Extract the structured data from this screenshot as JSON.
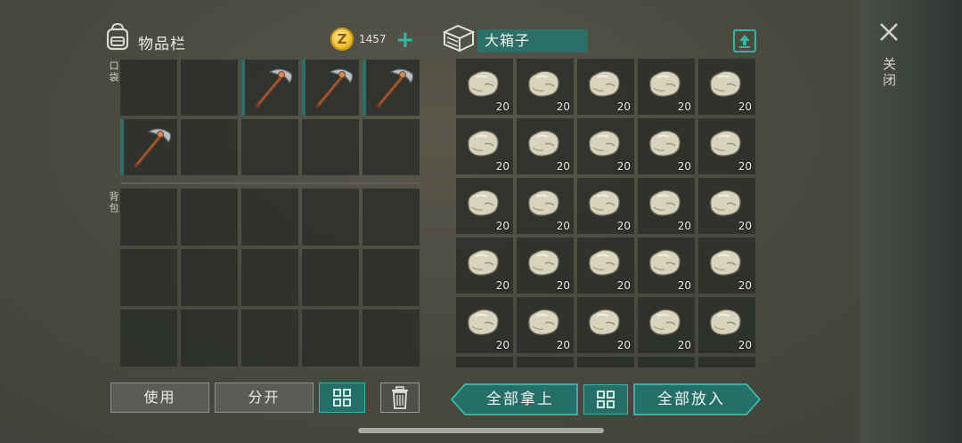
{
  "inventory": {
    "title": "物品栏",
    "pocket_label": "口袋",
    "backpack_label": "背包",
    "pocket_slots": [
      "",
      "",
      "pickaxe",
      "pickaxe",
      "pickaxe",
      "pickaxe",
      "",
      "",
      "",
      ""
    ],
    "backpack_slots": [
      "",
      "",
      "",
      "",
      "",
      "",
      "",
      "",
      "",
      "",
      "",
      "",
      "",
      "",
      ""
    ]
  },
  "currency": {
    "coin_symbol": "Z",
    "amount": "1457",
    "add_symbol": "+"
  },
  "container": {
    "name": "大箱子",
    "item": "stone",
    "quantity_label": "20",
    "slot_count": 25
  },
  "actions": {
    "use": "使用",
    "split": "分开",
    "take_all": "全部拿上",
    "put_all": "全部放入"
  },
  "close": {
    "label": "关闭"
  },
  "colors": {
    "accent_teal": "#2fb7a3",
    "slot_bg": "#282b28",
    "coin_gold": "#f1c02d"
  },
  "icons": {
    "backpack": "backpack-icon",
    "coin": "coin-icon",
    "box": "box-icon",
    "upload": "upload-icon",
    "close": "close-icon",
    "sort": "sort-icon",
    "trash": "trash-icon",
    "pickaxe": "pickaxe-icon",
    "stone": "stone-icon"
  }
}
